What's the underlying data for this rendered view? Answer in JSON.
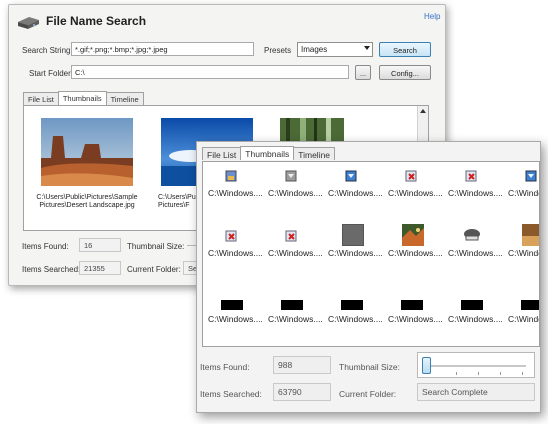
{
  "back_window": {
    "title": "File Name Search",
    "help": "Help",
    "search_string_label": "Search String",
    "search_string_value": "*.gif;*.png;*.bmp;*.jpg;*.jpeg",
    "presets_label": "Presets",
    "presets_value": "Images",
    "search_button": "Search",
    "start_folder_label": "Start Folder",
    "start_folder_value": "C:\\",
    "browse_button": "...",
    "config_button": "Config...",
    "tabs": [
      "File List",
      "Thumbnails",
      "Timeline"
    ],
    "active_tab": "Thumbnails",
    "thumbnails": [
      {
        "caption": "C:\\Users\\Public\\Pictures\\Sample Pictures\\Desert Landscape.jpg"
      },
      {
        "caption": "C:\\Users\\Public\\Pictures\\Sample Pictures\\F"
      },
      {
        "caption": ""
      }
    ],
    "items_found_label": "Items Found:",
    "items_found_value": "16",
    "thumbnail_size_label": "Thumbnail Size:",
    "items_searched_label": "Items Searched:",
    "items_searched_value": "21355",
    "current_folder_label": "Current Folder:",
    "current_folder_value": "Se"
  },
  "front_window": {
    "tabs": [
      "File List",
      "Thumbnails",
      "Timeline"
    ],
    "active_tab": "Thumbnails",
    "cell_caption": "C:\\Windows....",
    "rows": [
      {
        "icons": [
          "generic-image-icon",
          "gray-image-icon",
          "blue-image-icon",
          "broken-image-icon",
          "broken-image-icon",
          "blue-image-icon"
        ]
      },
      {
        "icons": [
          "broken-image-icon",
          "broken-image-icon",
          "gray-square-thumbnail",
          "photo-thumbnail",
          "network-icon",
          "photo-thumbnail"
        ]
      },
      {
        "icons": [
          "black-bar-thumbnail",
          "black-bar-thumbnail",
          "black-bar-thumbnail",
          "black-bar-thumbnail",
          "black-bar-thumbnail",
          "black-bar-thumbnail"
        ]
      }
    ],
    "items_found_label": "Items Found:",
    "items_found_value": "988",
    "thumbnail_size_label": "Thumbnail Size:",
    "items_searched_label": "Items Searched:",
    "items_searched_value": "63790",
    "current_folder_label": "Current Folder:",
    "current_folder_value": "Search Complete"
  }
}
